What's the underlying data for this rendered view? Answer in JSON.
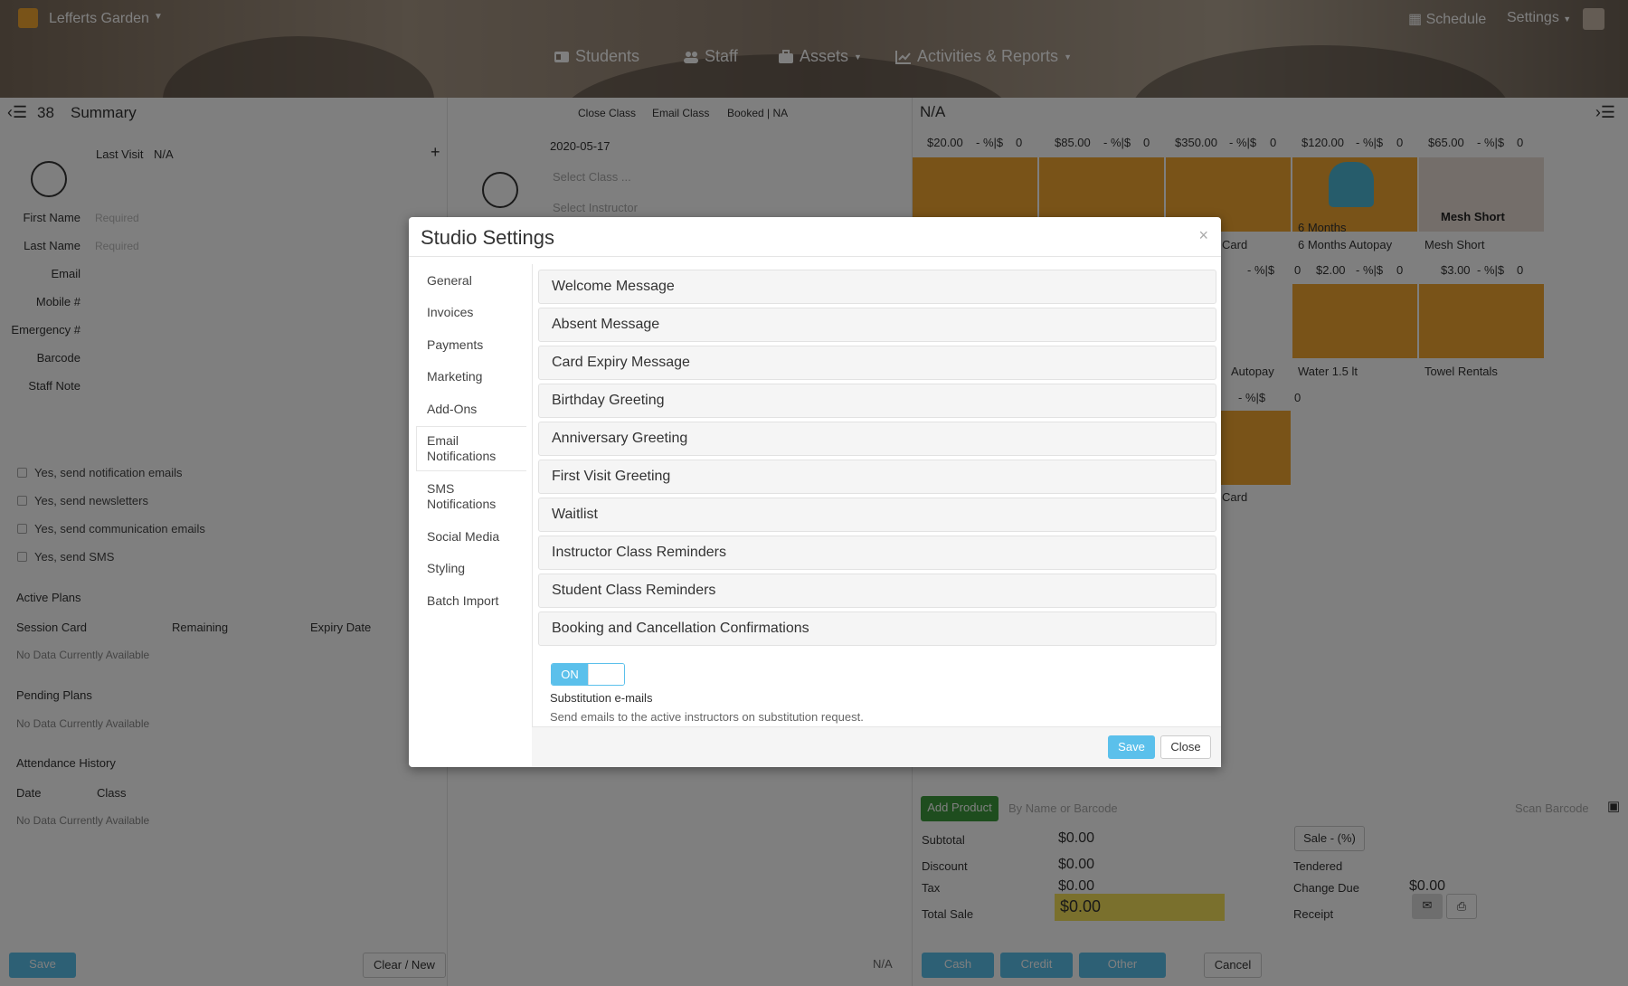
{
  "app": {
    "brand": "Lefferts Garden"
  },
  "top_right": {
    "schedule": "Schedule",
    "settings": "Settings"
  },
  "nav": [
    {
      "label": "Students",
      "icon": "id-card-icon"
    },
    {
      "label": "Staff",
      "icon": "users-icon"
    },
    {
      "label": "Assets",
      "icon": "briefcase-icon"
    },
    {
      "label": "Activities & Reports",
      "icon": "chart-icon"
    }
  ],
  "left_panel": {
    "count": "38",
    "title": "Summary",
    "last_visit_label": "Last Visit",
    "last_visit_value": "N/A",
    "fields": [
      {
        "label": "First Name",
        "placeholder": "Required"
      },
      {
        "label": "Last Name",
        "placeholder": "Required"
      },
      {
        "label": "Email",
        "placeholder": ""
      },
      {
        "label": "Mobile #",
        "placeholder": ""
      },
      {
        "label": "Emergency #",
        "placeholder": ""
      },
      {
        "label": "Barcode",
        "placeholder": ""
      },
      {
        "label": "Staff Note",
        "placeholder": ""
      }
    ],
    "checks": [
      "Yes, send notification emails",
      "Yes, send newsletters",
      "Yes, send communication emails",
      "Yes, send SMS"
    ],
    "active_plans": "Active Plans",
    "plan_cols": [
      "Session Card",
      "Remaining",
      "Expiry Date"
    ],
    "no_data": "No Data Currently Available",
    "pending_plans": "Pending Plans",
    "attendance": "Attendance History",
    "att_cols": [
      "Date",
      "Class"
    ],
    "save": "Save",
    "clear": "Clear / New"
  },
  "middle_panel": {
    "actions": [
      "Close Class",
      "Email Class",
      "Booked | NA"
    ],
    "date": "2020-05-17",
    "select_class": "Select Class ...",
    "select_instructor": "Select Instructor",
    "bottom_na": "N/A"
  },
  "right_panel": {
    "title": "N/A",
    "tiles": [
      {
        "price": "$20.00",
        "pct": "- %|$",
        "qty": "0",
        "name": ""
      },
      {
        "price": "$85.00",
        "pct": "- %|$",
        "qty": "0",
        "name": ""
      },
      {
        "price": "$350.00",
        "pct": "- %|$",
        "qty": "0",
        "name": "Card"
      },
      {
        "price": "$120.00",
        "pct": "- %|$",
        "qty": "0",
        "name": "6 Months Autopay"
      },
      {
        "price": "$65.00",
        "pct": "- %|$",
        "qty": "0",
        "name": "Mesh Short"
      },
      {
        "price": "",
        "pct": "- %|$",
        "qty": "0",
        "name": "Autopay"
      },
      {
        "price": "$2.00",
        "pct": "- %|$",
        "qty": "0",
        "name": "Water 1.5 lt"
      },
      {
        "price": "$3.00",
        "pct": "- %|$",
        "qty": "0",
        "name": "Towel Rentals"
      },
      {
        "price": "",
        "pct": "- %|$",
        "qty": "0",
        "name": "Card"
      }
    ],
    "mesh_overlay": "Mesh Short",
    "six_months_overlay": "6 Months",
    "add_product": "Add Product",
    "search_placeholder": "By Name or Barcode",
    "scan_barcode": "Scan Barcode",
    "subtotal_label": "Subtotal",
    "subtotal": "$0.00",
    "discount_label": "Discount",
    "discount": "$0.00",
    "tax_label": "Tax",
    "tax": "$0.00",
    "total_label": "Total Sale",
    "total": "$0.00",
    "sale_pct": "Sale - (%)",
    "tendered_label": "Tendered",
    "change_label": "Change Due",
    "change": "$0.00",
    "receipt_label": "Receipt",
    "pay_buttons": [
      "Cash",
      "Credit",
      "Other"
    ],
    "cancel": "Cancel"
  },
  "modal": {
    "title": "Studio Settings",
    "close_x": "×",
    "tabs": [
      "General",
      "Invoices",
      "Payments",
      "Marketing",
      "Add-Ons",
      "Email Notifications",
      "SMS Notifications",
      "Social Media",
      "Styling",
      "Batch Import"
    ],
    "active_tab": "Email Notifications",
    "sections": [
      "Welcome Message",
      "Absent Message",
      "Card Expiry Message",
      "Birthday Greeting",
      "Anniversary Greeting",
      "First Visit Greeting",
      "Waitlist",
      "Instructor Class Reminders",
      "Student Class Reminders",
      "Booking and Cancellation Confirmations"
    ],
    "toggle_label": "ON",
    "toggle_state": "on",
    "setting_title": "Substitution e-mails",
    "setting_desc": "Send emails to the active instructors on substitution request.",
    "save": "Save",
    "close": "Close",
    "accent": "#5bc0eb"
  }
}
